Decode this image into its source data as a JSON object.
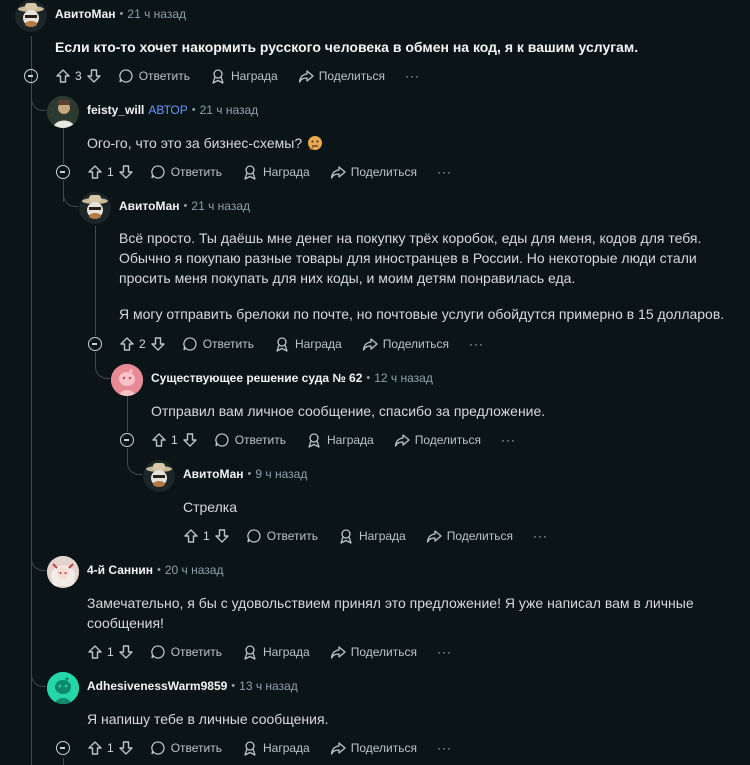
{
  "labels": {
    "reply": "Ответить",
    "award": "Награда",
    "share": "Поделиться",
    "more": "···",
    "op_badge": "АВТОР"
  },
  "comments": [
    {
      "author": "АвитоМан",
      "time": "21 ч назад",
      "body": "Если кто-то хочет накормить русского человека в обмен на код, я к вашим услугам.",
      "votes": "3"
    },
    {
      "author": "feisty_will",
      "time": "21 ч назад",
      "body": "Ого-го, что это за бизнес-схемы?",
      "votes": "1"
    },
    {
      "author": "АвитоМан",
      "time": "21 ч назад",
      "body1": "Всё просто. Ты даёшь мне денег на покупку трёх коробок, еды для меня, кодов для тебя. Обычно я покупаю разные товары для иностранцев в России. Но некоторые люди стали просить меня покупать для них коды, и моим детям понравилась еда.",
      "body2": "Я могу отправить брелоки по почте, но почтовые услуги обойдутся примерно в 15 долларов.",
      "votes": "2"
    },
    {
      "author": "Существующее решение суда № 62",
      "time": "12 ч назад",
      "body": "Отправил вам личное сообщение, спасибо за предложение.",
      "votes": "1"
    },
    {
      "author": "АвитоМан",
      "time": "9 ч назад",
      "body": "Стрелка",
      "votes": "1"
    },
    {
      "author": "4-й Саннин",
      "time": "20 ч назад",
      "body": "Замечательно, я бы с удовольствием принял это предложение! Я уже написал вам в личные сообщения!",
      "votes": "1"
    },
    {
      "author": "AdhesivenessWarm9859",
      "time": "13 ч назад",
      "body": "Я напишу тебе в личные сообщения.",
      "votes": "1"
    }
  ]
}
